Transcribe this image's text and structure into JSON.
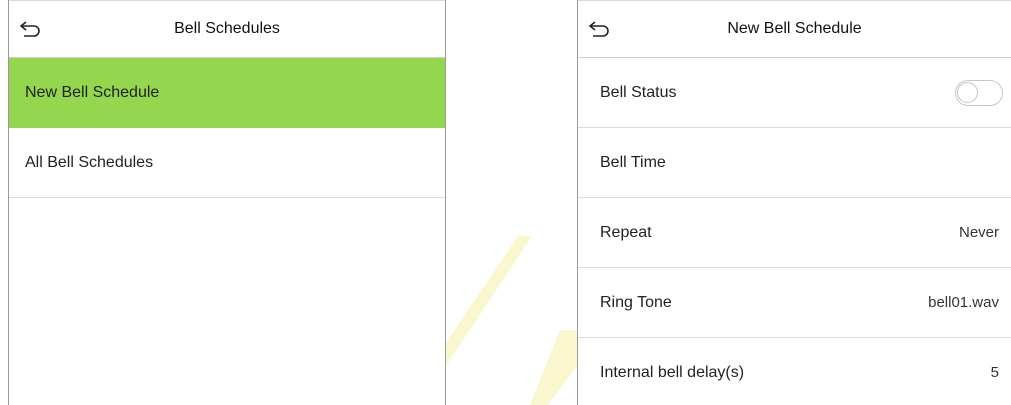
{
  "left_screen": {
    "title": "Bell Schedules",
    "items": [
      {
        "label": "New Bell Schedule",
        "selected": true
      },
      {
        "label": "All Bell Schedules",
        "selected": false
      }
    ]
  },
  "right_screen": {
    "title": "New Bell Schedule",
    "bell_status": {
      "label": "Bell Status",
      "enabled": false
    },
    "bell_time": {
      "label": "Bell Time",
      "value": ""
    },
    "repeat": {
      "label": "Repeat",
      "value": "Never"
    },
    "ring_tone": {
      "label": "Ring Tone",
      "value": "bell01.wav"
    },
    "internal_bell_delay": {
      "label": "Internal bell delay(s)",
      "value": "5"
    }
  },
  "colors": {
    "selected_row": "#94d64e",
    "watermark": "#f5f1a8"
  },
  "icons": [
    "back-arrow-icon"
  ]
}
